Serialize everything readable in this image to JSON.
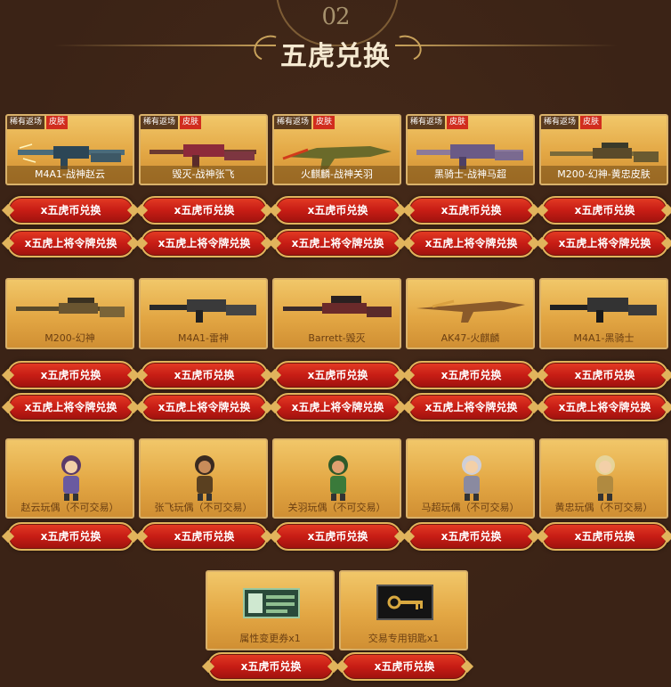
{
  "header": {
    "number": "02",
    "title": "五虎兑换"
  },
  "tags": {
    "rare": "稀有返场",
    "skin": "皮肤"
  },
  "buttons": {
    "coin": "x五虎币兑换",
    "token": "x五虎上将令牌兑换"
  },
  "rows": {
    "skins": [
      {
        "name": "M4A1-战神赵云"
      },
      {
        "name": "毁灭-战神张飞"
      },
      {
        "name": "火麒麟-战神关羽"
      },
      {
        "name": "黑骑士-战神马超"
      },
      {
        "name": "M200-幻神-黄忠皮肤"
      }
    ],
    "weapons": [
      {
        "name": "M200-幻神"
      },
      {
        "name": "M4A1-雷神"
      },
      {
        "name": "Barrett-毁灭"
      },
      {
        "name": "AK47-火麒麟"
      },
      {
        "name": "M4A1-黑骑士"
      }
    ],
    "toys": [
      {
        "name": "赵云玩偶（不可交易）"
      },
      {
        "name": "张飞玩偶（不可交易）"
      },
      {
        "name": "关羽玩偶（不可交易）"
      },
      {
        "name": "马超玩偶（不可交易）"
      },
      {
        "name": "黄忠玩偶（不可交易）"
      }
    ],
    "items": [
      {
        "name": "属性变更券x1",
        "icon": "ticket-icon"
      },
      {
        "name": "交易专用钥匙x1",
        "icon": "key-icon"
      }
    ]
  },
  "colors": {
    "background": "#3b2316",
    "button": "#c71d15",
    "card": "#e3a744",
    "skin_tag": "#d12d1e"
  }
}
